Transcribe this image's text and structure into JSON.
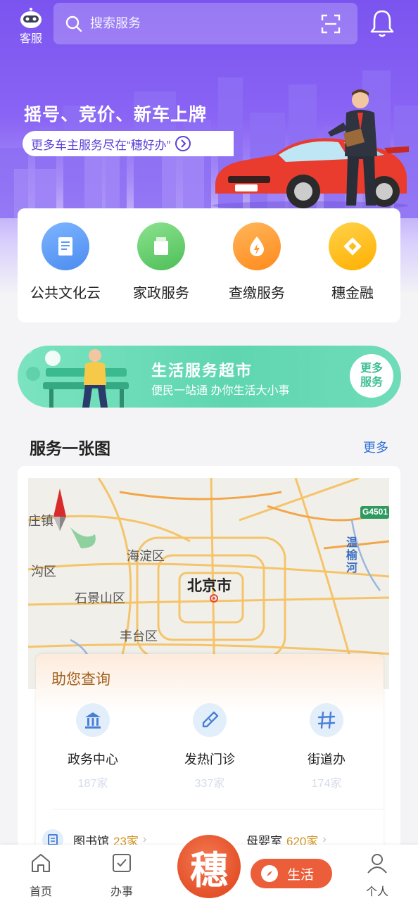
{
  "header": {
    "kefu_label": "客服",
    "search_placeholder": "搜索服务"
  },
  "promo": {
    "title": "摇号、竞价、新车上牌",
    "subtitle": "更多车主服务尽在“穗好办”"
  },
  "quick_services": [
    {
      "label": "公共文化云",
      "icon": "document-icon",
      "color": "#5a9cf5"
    },
    {
      "label": "家政服务",
      "icon": "housekeeping-icon",
      "color": "#5fcf69"
    },
    {
      "label": "查缴服务",
      "icon": "payment-drop-icon",
      "color": "#ff9a2e"
    },
    {
      "label": "穗金融",
      "icon": "finance-coin-icon",
      "color": "#ffbe1a"
    }
  ],
  "life_banner": {
    "title": "生活服务超市",
    "subtitle": "便民一站通  办你生活大小事",
    "more_line1": "更多",
    "more_line2": "服务"
  },
  "service_map": {
    "title": "服务一张图",
    "more": "更多",
    "map_labels": {
      "town": "庄镇",
      "haidian": "海淀区",
      "gou": "沟区",
      "city": "北京市",
      "shijingshan": "石景山区",
      "fengtai": "丰台区",
      "river": "温榆河",
      "highway": "G4501"
    },
    "helper_title": "助您查询",
    "helper_items": [
      {
        "name": "政务中心",
        "count": "187家",
        "icon": "government-building-icon"
      },
      {
        "name": "发热门诊",
        "count": "337家",
        "icon": "thermometer-icon"
      },
      {
        "name": "街道办",
        "count": "174家",
        "icon": "street-office-icon"
      }
    ],
    "bottom_rows": [
      {
        "name": "图书馆",
        "count": "23家",
        "icon": "library-icon"
      },
      {
        "name": "母婴室",
        "count": "620家",
        "icon": "baby-room-icon"
      }
    ]
  },
  "bottom_nav": {
    "home": "首页",
    "tasks": "办事",
    "logo_char": "穗",
    "life": "生活",
    "profile": "个人"
  }
}
